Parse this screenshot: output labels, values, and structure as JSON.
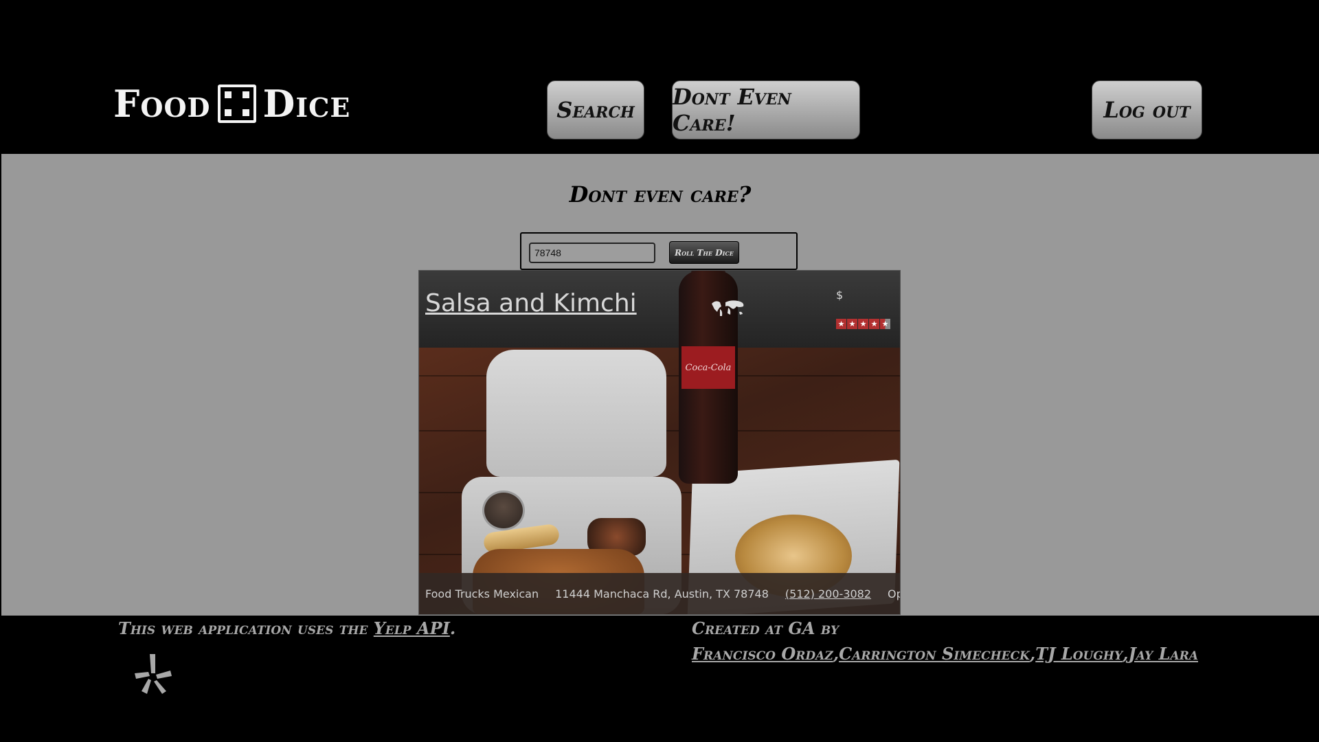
{
  "header": {
    "logo_left": "Food",
    "logo_right": "Dice",
    "nav": {
      "search_label": "Search",
      "dont_care_label": "Dont Even Care!",
      "logout_label": "Log out"
    }
  },
  "main": {
    "title": "Dont even care?",
    "zip_input": {
      "value": "78748"
    },
    "roll_button_label": "Roll The Dice"
  },
  "result": {
    "name": "Salsa and Kimchi",
    "price": "$",
    "rating_stars": 4.5,
    "rating_max": 5,
    "photo_label": "Coca-Cola",
    "categories": "Food Trucks Mexican",
    "address": "11444 Manchaca Rd, Austin, TX 78748",
    "phone": "(512) 200-3082",
    "status": "Opened"
  },
  "footer": {
    "yelp_prefix": "This web application uses the",
    "yelp_link": "Yelp API",
    "yelp_suffix": ".",
    "credits_prefix": "Created at GA by",
    "authors": [
      "Francisco Ordaz",
      "Carrington Simecheck",
      "TJ Loughy",
      "Jay Lara"
    ],
    "author_separator": ","
  },
  "icons": [
    "dice-icon",
    "world-map-icon",
    "star-icon",
    "yelp-icon"
  ]
}
